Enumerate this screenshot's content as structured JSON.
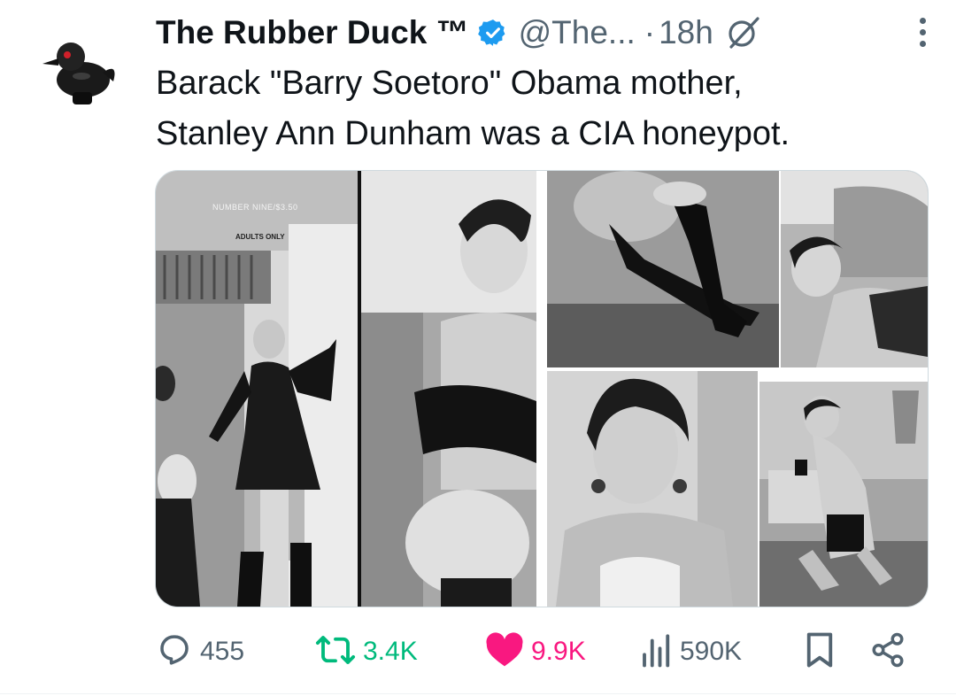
{
  "tweet": {
    "author_name": "The Rubber Duck ™",
    "handle": "@The...",
    "separator": "·",
    "time_ago": "18h",
    "text_lines": [
      "Barack \"Barry Soetoro\" Obama mother,",
      "Stanley Ann Dunham was a CIA honeypot."
    ]
  },
  "media": {
    "magazine_cover_line": "NUMBER NINE/$3.50",
    "magazine_tag": "ADULTS ONLY"
  },
  "actions": {
    "replies": "455",
    "reposts": "3.4K",
    "likes": "9.9K",
    "views": "590K"
  },
  "icons": {
    "verified": "verified-badge-icon",
    "grok": "grok-icon",
    "more": "more-icon",
    "reply": "reply-icon",
    "repost": "repost-icon",
    "like": "heart-icon",
    "views": "views-icon",
    "bookmark": "bookmark-icon",
    "share": "share-icon"
  },
  "colors": {
    "text": "#0f1419",
    "secondary": "#536471",
    "verified": "#1d9bf0",
    "repost": "#00ba7c",
    "like": "#f91880"
  }
}
